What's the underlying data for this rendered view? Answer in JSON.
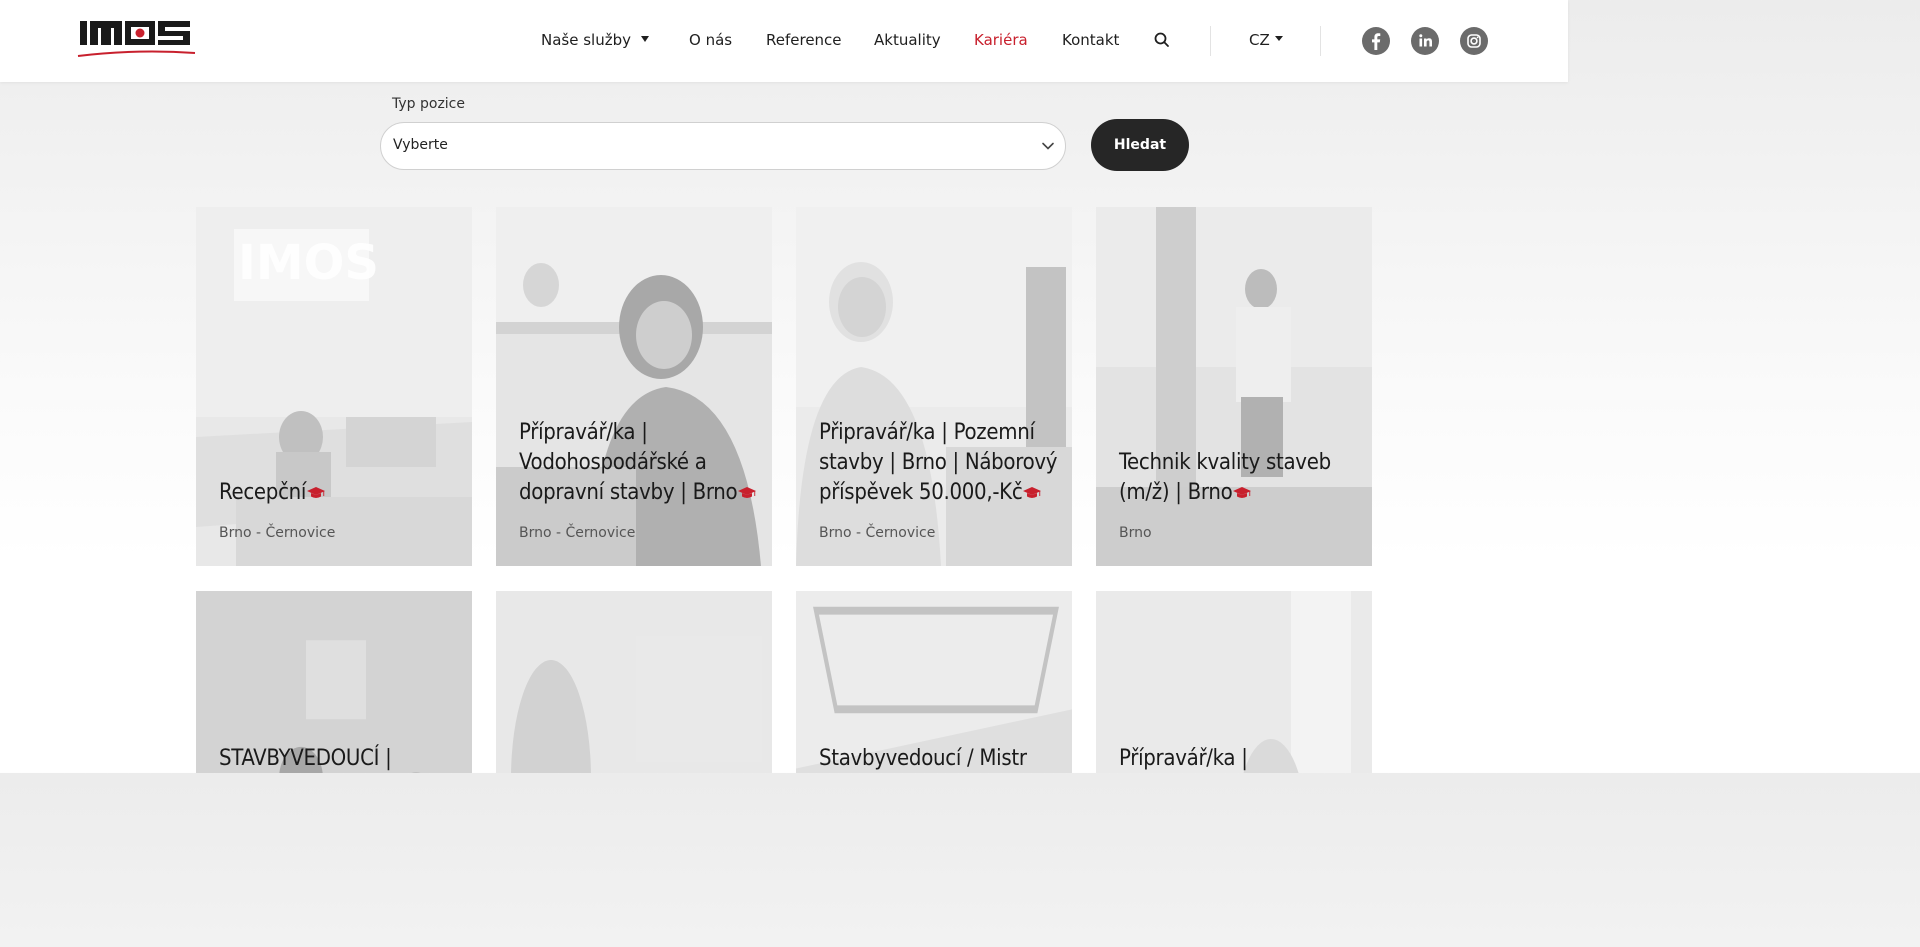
{
  "header": {
    "logo_text": "IMOS",
    "nav": [
      {
        "label": "Naše služby",
        "has_dropdown": true,
        "active": false
      },
      {
        "label": "O nás",
        "active": false
      },
      {
        "label": "Reference",
        "active": false
      },
      {
        "label": "Aktuality",
        "active": false
      },
      {
        "label": "Kariéra",
        "active": true
      },
      {
        "label": "Kontakt",
        "active": false
      }
    ],
    "search_icon": "search-icon",
    "language": "CZ",
    "social": [
      "facebook-icon",
      "linkedin-icon",
      "instagram-icon"
    ],
    "accent_color": "#c8202d"
  },
  "filter": {
    "label": "Typ pozice",
    "select_value": "Vyberte",
    "button_label": "Hledat"
  },
  "cards": [
    {
      "title": "Recepční",
      "location": "Brno - Černovice",
      "icon": "graduation-cap-icon"
    },
    {
      "title": "Přípravář/ka | Vodohospodářské a dopravní stavby | Brno",
      "location": "Brno - Černovice",
      "icon": "graduation-cap-icon"
    },
    {
      "title": "Připravář/ka | Pozemní stavby | Brno | Náborový příspěvek 50.000,-Kč",
      "location": "Brno - Černovice",
      "icon": "graduation-cap-icon"
    },
    {
      "title": "Technik kvality staveb (m/ž) | Brno",
      "location": "Brno",
      "icon": "graduation-cap-icon"
    },
    {
      "title": "STAVBYVEDOUCÍ |",
      "location": ""
    },
    {
      "title": "",
      "location": ""
    },
    {
      "title": "Stavbyvedoucí / Mistr",
      "location": ""
    },
    {
      "title": "Přípravář/ka |",
      "location": ""
    }
  ]
}
